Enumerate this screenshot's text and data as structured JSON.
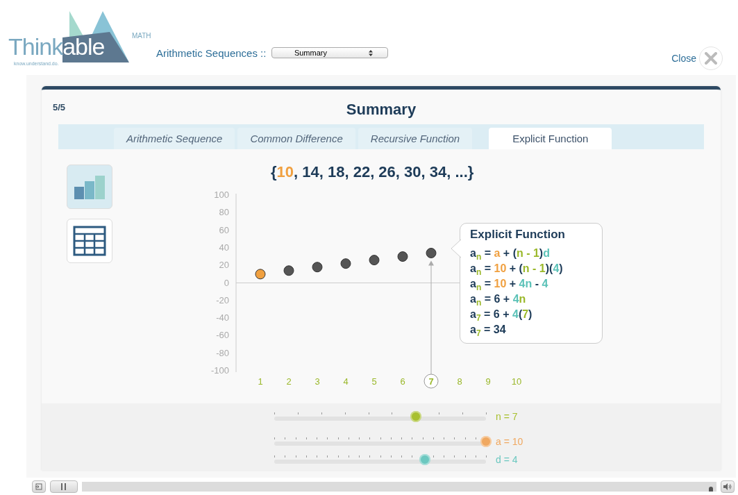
{
  "header": {
    "logo": {
      "wordmark": [
        "Think",
        "able"
      ],
      "tag": "MATH",
      "slogan": "know.understand.do."
    },
    "lesson": "Arithmetic Sequences ::",
    "section_select": "Summary",
    "close": "Close"
  },
  "card": {
    "progress": "5/5",
    "title": "Summary",
    "tabs": [
      {
        "label": "Arithmetic Sequence",
        "selected": false
      },
      {
        "label": "Common Difference",
        "selected": false
      },
      {
        "label": "Recursive Function",
        "selected": false
      },
      {
        "label": "Explicit Function",
        "selected": true
      }
    ],
    "views": [
      {
        "kind": "chart",
        "selected": true
      },
      {
        "kind": "table",
        "selected": false
      }
    ],
    "sequence": [
      {
        "text": "{",
        "color": "#1d3b58"
      },
      {
        "text": "10",
        "color": "#f0a040"
      },
      {
        "text": ", 14, 18, 22, 26, 30, 34, ...}",
        "color": "#1d3b58"
      }
    ],
    "chart_data": {
      "type": "scatter",
      "x": [
        1,
        2,
        3,
        4,
        5,
        6,
        7
      ],
      "series": [
        {
          "color": "#f0a040",
          "values": [
            10,
            null,
            null,
            null,
            null,
            null,
            null
          ]
        },
        {
          "color": "#555555",
          "values": [
            null,
            14,
            18,
            22,
            26,
            30,
            34
          ]
        }
      ],
      "xlim": [
        1,
        10
      ],
      "ylim": [
        -100,
        100
      ],
      "xticks": [
        1,
        2,
        3,
        4,
        5,
        6,
        7,
        8,
        9,
        10
      ],
      "yticks": [
        -100,
        -80,
        -60,
        -40,
        -20,
        0,
        20,
        40,
        60,
        80,
        100
      ]
    },
    "callout": {
      "title": "Explicit Function",
      "lines": [
        [
          {
            "text": "a",
            "color": "#1d3b58"
          },
          {
            "text": "n",
            "color": "#9ab82a",
            "kind": "sub"
          },
          {
            "text": " = ",
            "color": "#1d3b58"
          },
          {
            "text": "a",
            "color": "#f0a040"
          },
          {
            "text": " + (",
            "color": "#1d3b58"
          },
          {
            "text": "n - 1",
            "color": "#9ab82a"
          },
          {
            "text": ")",
            "color": "#1d3b58"
          },
          {
            "text": "d",
            "color": "#5cc2b8"
          }
        ],
        [
          {
            "text": "a",
            "color": "#1d3b58"
          },
          {
            "text": "n",
            "color": "#9ab82a",
            "kind": "sub"
          },
          {
            "text": " = ",
            "color": "#1d3b58"
          },
          {
            "text": "10",
            "color": "#f0a040"
          },
          {
            "text": " + (",
            "color": "#1d3b58"
          },
          {
            "text": "n - 1",
            "color": "#9ab82a"
          },
          {
            "text": ")(",
            "color": "#1d3b58"
          },
          {
            "text": "4",
            "color": "#5cc2b8"
          },
          {
            "text": ")",
            "color": "#1d3b58"
          }
        ],
        [
          {
            "text": "a",
            "color": "#1d3b58"
          },
          {
            "text": "n",
            "color": "#9ab82a",
            "kind": "sub"
          },
          {
            "text": " = ",
            "color": "#1d3b58"
          },
          {
            "text": "10",
            "color": "#f0a040"
          },
          {
            "text": " + ",
            "color": "#1d3b58"
          },
          {
            "text": "4n",
            "color": "#5cc2b8"
          },
          {
            "text": " - ",
            "color": "#1d3b58"
          },
          {
            "text": "4",
            "color": "#5cc2b8"
          }
        ],
        [
          {
            "text": "a",
            "color": "#1d3b58"
          },
          {
            "text": "n",
            "color": "#9ab82a",
            "kind": "sub"
          },
          {
            "text": " = 6 + ",
            "color": "#1d3b58"
          },
          {
            "text": "4",
            "color": "#5cc2b8"
          },
          {
            "text": "n",
            "color": "#9ab82a"
          }
        ],
        [
          {
            "text": "a",
            "color": "#1d3b58"
          },
          {
            "text": "7",
            "color": "#9ab82a",
            "kind": "sub"
          },
          {
            "text": " = 6 + ",
            "color": "#1d3b58"
          },
          {
            "text": "4",
            "color": "#5cc2b8"
          },
          {
            "text": "(",
            "color": "#1d3b58"
          },
          {
            "text": "7",
            "color": "#9ab82a"
          },
          {
            "text": ")",
            "color": "#1d3b58"
          }
        ],
        [
          {
            "text": "a",
            "color": "#1d3b58"
          },
          {
            "text": "7",
            "color": "#9ab82a",
            "kind": "sub"
          },
          {
            "text": " = 34",
            "color": "#1d3b58"
          }
        ]
      ]
    },
    "sliders": [
      {
        "reading": "n =  7",
        "color": "#a8c030",
        "level": 0.67
      },
      {
        "reading": "a =  10",
        "color": "#f0a860",
        "level": 1.0
      },
      {
        "reading": "d =  4",
        "color": "#6cc8c0",
        "level": 0.71
      }
    ]
  },
  "player": {
    "level": 0.995
  }
}
